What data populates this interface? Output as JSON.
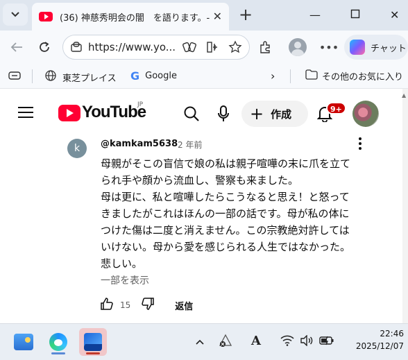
{
  "browser": {
    "tab_title": "(36) 神慈秀明会の闇　を語ります。-",
    "url": "https://www.yo...",
    "copilot_label": "チャット",
    "favorites": [
      {
        "label": "東芝プレイス",
        "icon": "globe-icon"
      },
      {
        "label": "Google",
        "icon": "google-icon"
      }
    ],
    "other_favorites_label": "その他のお気に入り"
  },
  "youtube": {
    "logo_text": "YouTube",
    "region": "JP",
    "create_label": "作成",
    "notification_badge": "9+"
  },
  "comment": {
    "avatar_letter": "k",
    "author": "@kamkam5638",
    "time": "2 年前",
    "lines": [
      "母親がそこの盲信で娘の私は親子喧嘩の末に爪を立て",
      "られ手や顔から流血し、警察も来ました。",
      "母は更に、私と喧嘩したらこうなると思え！と怒って",
      "きましたがこれはほんの一部の話です。母が私の体に",
      "つけた傷は二度と消えません。この宗教絶対許しては",
      "いけない。母から愛を感じられる人生ではなかった。",
      "悲しい。"
    ],
    "read_more": "一部を表示",
    "likes": "15",
    "reply_label": "返信"
  },
  "taskbar": {
    "time": "22:46",
    "date": "2025/12/07"
  }
}
